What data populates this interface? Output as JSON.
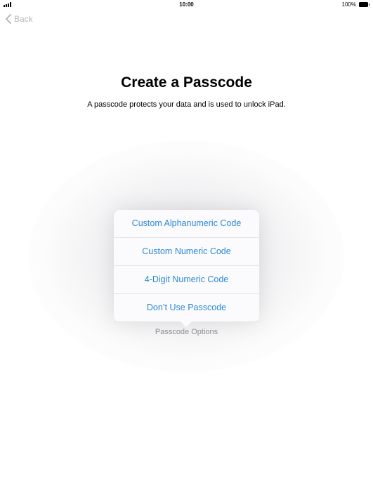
{
  "status_bar": {
    "time": "10:00",
    "battery_percent": "100%"
  },
  "nav": {
    "back_label": "Back"
  },
  "page": {
    "title": "Create a Passcode",
    "subtitle": "A passcode protects your data and is used to unlock iPad."
  },
  "popover": {
    "items": [
      {
        "label": "Custom Alphanumeric Code"
      },
      {
        "label": "Custom Numeric Code"
      },
      {
        "label": "4-Digit Numeric Code"
      },
      {
        "label": "Don’t Use Passcode"
      }
    ],
    "caption": "Passcode Options"
  },
  "colors": {
    "accent": "#2d88d4",
    "back_disabled": "#b9b9be",
    "caption": "#8e8e93"
  }
}
